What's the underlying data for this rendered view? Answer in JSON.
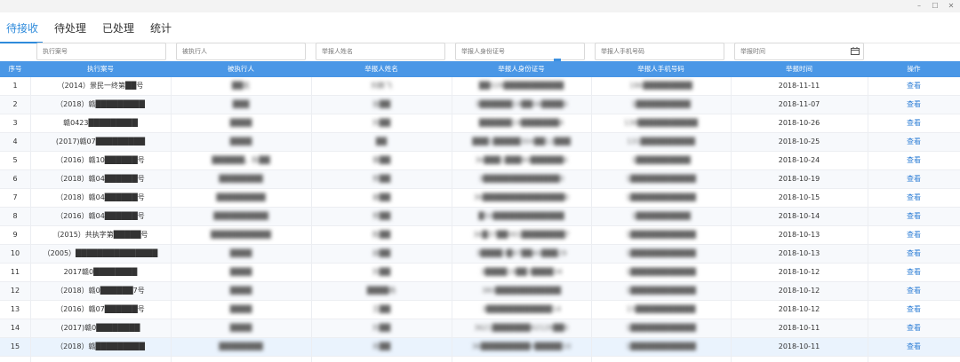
{
  "window": {
    "min": "–",
    "max": "☐",
    "close": "✕"
  },
  "tabs": [
    {
      "label": "待接收",
      "active": true
    },
    {
      "label": "待处理",
      "active": false
    },
    {
      "label": "已处理",
      "active": false
    },
    {
      "label": "统计",
      "active": false
    }
  ],
  "filters": {
    "case_no": "执行案号",
    "executed": "被执行人",
    "reporter_name": "举报人姓名",
    "reporter_id": "举报人身份证号",
    "reporter_phone": "举报人手机号码",
    "report_time": "举报时间"
  },
  "table": {
    "headers": [
      "序号",
      "执行案号",
      "被执行人",
      "举报人姓名",
      "举报人身份证号",
      "举报人手机号码",
      "举报时间",
      "操作"
    ],
    "view_label": "查看",
    "rows": [
      {
        "no": "1",
        "case": "（2014）景民一终第██号",
        "executed": "██医",
        "name": "刘鹏飞",
        "id": "██028███████████",
        "phone": "186█████████",
        "date": "2018-11-11"
      },
      {
        "no": "2",
        "case": "（2018）赣█████████",
        "executed": "███",
        "name": "张██",
        "id": "3██████19██06████0",
        "phone": "1██████████",
        "date": "2018-11-07"
      },
      {
        "no": "3",
        "case": "赣0423█████████",
        "executed": "████",
        "name": "刘██",
        "id": "██████19███████4",
        "phone": "138███████████",
        "date": "2018-10-26"
      },
      {
        "no": "4",
        "case": "(2017)赣07█████████",
        "executed": "████",
        "name": "██",
        "id": "███1█████304██12███",
        "phone": "131██████████",
        "date": "2018-10-25"
      },
      {
        "no": "5",
        "case": "（2016）赣10██████号",
        "executed": "██████，陈██",
        "name": "曾██",
        "id": "36███1███90██████0",
        "phone": "1██████████",
        "date": "2018-10-24"
      },
      {
        "no": "6",
        "case": "（2018）赣04██████号",
        "executed": "████████",
        "name": "贺██",
        "id": "3██████████████0",
        "phone": "1████████████",
        "date": "2018-10-19"
      },
      {
        "no": "7",
        "case": "（2018）赣04██████号",
        "executed": "█████████",
        "name": "谢██",
        "id": "36███████████████0",
        "phone": "1████████████",
        "date": "2018-10-15"
      },
      {
        "no": "8",
        "case": "（2016）赣04██████号",
        "executed": "██████████",
        "name": "贺██",
        "id": "█50█████████████",
        "phone": "1██████████",
        "date": "2018-10-14"
      },
      {
        "no": "9",
        "case": "（2015）共执字第█████号",
        "executed": "███████████",
        "name": "陈██",
        "id": "36█37██991████████7",
        "phone": "1████████████",
        "date": "2018-10-13"
      },
      {
        "no": "10",
        "case": "（2005）███████████████",
        "executed": "████",
        "name": "胡██",
        "id": "3████3█97██40███29",
        "phone": "1████████████",
        "date": "2018-10-13"
      },
      {
        "no": "11",
        "case": "2017赣0████████",
        "executed": "████",
        "name": "刘██",
        "id": "3████19██3████34",
        "phone": "1████████████",
        "date": "2018-10-12"
      },
      {
        "no": "12",
        "case": "（2018）赣0██████7号",
        "executed": "████",
        "name": "████杨",
        "id": "380████████████",
        "phone": "1████████████",
        "date": "2018-10-12"
      },
      {
        "no": "13",
        "case": "（2016）赣07██████号",
        "executed": "████",
        "name": "王██",
        "id": "3████████████14",
        "phone": "15███████████",
        "date": "2018-10-12"
      },
      {
        "no": "14",
        "case": "(2017)赣0████████",
        "executed": "████",
        "name": "刘██",
        "id": "3621███████42128██0",
        "phone": "1████████████",
        "date": "2018-10-11"
      },
      {
        "no": "15",
        "case": "（2018）赣█████████",
        "executed": "████████",
        "name": "肖██",
        "id": "36█████████0█████10",
        "phone": "1████████████",
        "date": "2018-10-11"
      }
    ]
  }
}
